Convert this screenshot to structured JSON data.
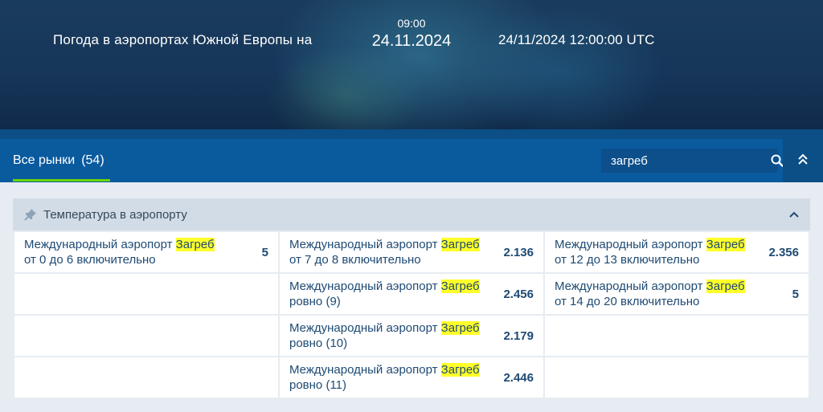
{
  "header": {
    "title": "Погода в аэропортах Южной Европы на",
    "time": "09:00",
    "date": "24.11.2024",
    "utc": "24/11/2024 12:00:00 UTC"
  },
  "tabs": {
    "all_markets": "Все рынки",
    "count": "(54)"
  },
  "search": {
    "value": "загреб",
    "placeholder": ""
  },
  "panel": {
    "title": "Температура в аэропорту",
    "highlight_word": "Загреб"
  },
  "markets": [
    {
      "before": "Международный аэропорт ",
      "hl": "Загреб",
      "after": " от 0 до 6 включительно",
      "odds": "5"
    },
    {
      "before": "Международный аэропорт ",
      "hl": "Загреб",
      "after": " от 7 до 8 включительно",
      "odds": "2.136"
    },
    {
      "before": "Международный аэропорт ",
      "hl": "Загреб",
      "after": " от 12 до 13 включительно",
      "odds": "2.356"
    },
    {
      "before": "",
      "hl": "",
      "after": "",
      "odds": ""
    },
    {
      "before": "Международный аэропорт ",
      "hl": "Загреб",
      "after": " ровно (9)",
      "odds": "2.456"
    },
    {
      "before": "Международный аэропорт ",
      "hl": "Загреб",
      "after": " от 14 до 20 включительно",
      "odds": "5"
    },
    {
      "before": "",
      "hl": "",
      "after": "",
      "odds": ""
    },
    {
      "before": "Международный аэропорт ",
      "hl": "Загреб",
      "after": " ровно (10)",
      "odds": "2.179"
    },
    {
      "before": "",
      "hl": "",
      "after": "",
      "odds": ""
    },
    {
      "before": "",
      "hl": "",
      "after": "",
      "odds": ""
    },
    {
      "before": "Международный аэропорт ",
      "hl": "Загреб",
      "after": " ровно (11)",
      "odds": "2.446"
    },
    {
      "before": "",
      "hl": "",
      "after": "",
      "odds": ""
    }
  ],
  "colors": {
    "accent_underline": "#6dd400",
    "highlight": "#ffff2a",
    "tabbar": "#0a5a9e",
    "text": "#1e4a74"
  },
  "icons": {
    "search": "search-icon",
    "collapse": "double-chevron-up-icon",
    "pin": "pin-icon",
    "panel_toggle": "chevron-up-icon"
  }
}
